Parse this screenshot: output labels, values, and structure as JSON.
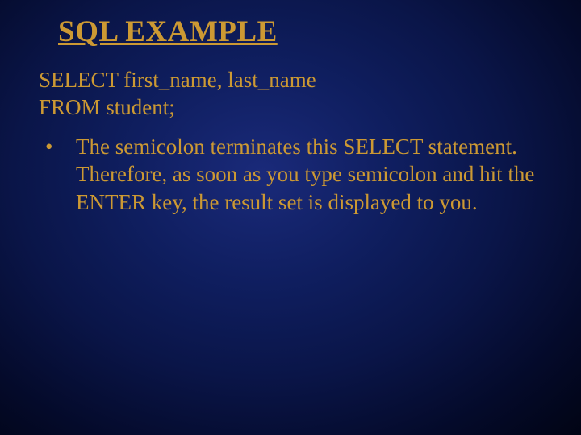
{
  "slide": {
    "title": "SQL EXAMPLE",
    "code": {
      "line1": "SELECT first_name, last_name",
      "line2": "FROM student;"
    },
    "bullets": [
      {
        "text": "The semicolon terminates this SELECT statement. Therefore, as soon as you type semicolon and hit the ENTER key, the result set is displayed to you."
      }
    ]
  }
}
